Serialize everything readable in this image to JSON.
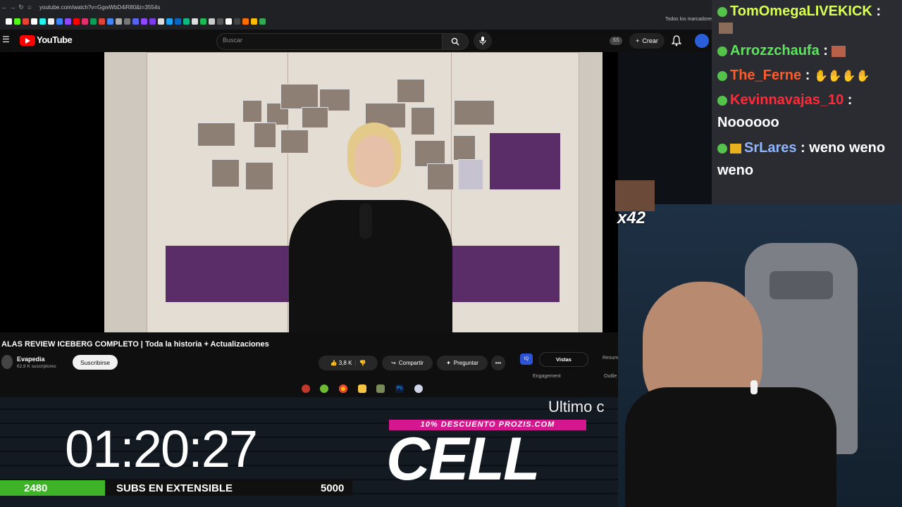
{
  "browser": {
    "url": "youtube.com/watch?v=GgwWbD4iR80&t=3554s",
    "bookmarks_all": "Todos los marcadores"
  },
  "youtube": {
    "logo_text": "YouTube",
    "search_placeholder": "Buscar",
    "ss_badge": "SS",
    "create_label": "Crear"
  },
  "video": {
    "title": "ALAS REVIEW ICEBERG COMPLETO | Toda la historia + Actualizaciones",
    "channel_name": "Evapedia",
    "channel_subs": "62,9 K suscriptores",
    "subscribe_label": "Suscribirse",
    "likes": "3,8 K",
    "share_label": "Compartir",
    "ask_label": "Preguntar",
    "more_label": "•••"
  },
  "extension": {
    "iq_label": "IQ",
    "tab_active": "Vistas",
    "tab_other": "Resum",
    "engagement": "Engagement",
    "outliers": "Outlie"
  },
  "overlay": {
    "timer": "01:20:27",
    "subs_current": "2480",
    "subs_label": "SUBS EN EXTENSIBLE",
    "subs_goal": "5000",
    "subs_progress": 0.496,
    "ticker": "Ultimo c",
    "promo": "10% DESCUENTO PROZIS.COM",
    "promo_code": "CELL",
    "emote_count": "x42",
    "accent_green": "#3fb327",
    "accent_pink": "#d4168f"
  },
  "chat": [
    {
      "user": "TomOmegaLIVEKICK",
      "color": "#d9ff52",
      "msg": ""
    },
    {
      "user": "Arrozzchaufa",
      "color": "#5fe35f",
      "msg": ""
    },
    {
      "user": "The_Ferne",
      "color": "#ff5a2a",
      "msg": ""
    },
    {
      "user": "Kevinnavajas_10",
      "color": "#ff2a3a",
      "msg": "Noooooo"
    },
    {
      "user": "SrLares",
      "color": "#8fb6ff",
      "msg": "weno weno weno"
    }
  ]
}
